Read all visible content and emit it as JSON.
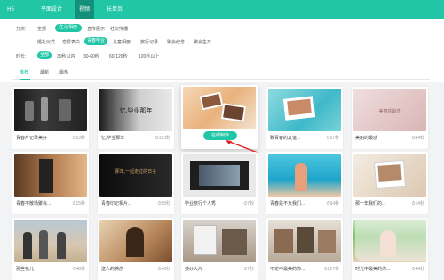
{
  "topnav": {
    "tabs": [
      "H5",
      "平面设计",
      "视频",
      "长单页"
    ],
    "active_index": 2
  },
  "filters": {
    "category_label": "分类:",
    "categories": [
      "全部",
      "生活相册",
      "宣传展示",
      "社交传播"
    ],
    "active_category_index": 1,
    "subcategories": [
      "婚礼仪式",
      "恋爱表白",
      "青春毕业",
      "儿童相册",
      "旅行记录",
      "聚会纪念",
      "聚会生日"
    ],
    "active_subcategory_index": 2,
    "duration_label": "时长:",
    "durations": [
      "全部",
      "30秒以内",
      "30-60秒",
      "60-120秒",
      "120秒以上"
    ],
    "active_duration_index": 0
  },
  "sort": {
    "tabs": [
      "推荐",
      "最新",
      "最热"
    ],
    "active_index": 0
  },
  "cards": [
    {
      "title": "青春片记录美好",
      "duration": "63秒",
      "caption": ""
    },
    {
      "title": "忆,毕业那年",
      "duration": "153秒",
      "caption": "忆,毕业那年"
    },
    {
      "title": "",
      "duration": "",
      "caption": "",
      "hover": true,
      "button": "在线制作"
    },
    {
      "title": "致青春的友谊...",
      "duration": "57秒",
      "caption": ""
    },
    {
      "title": "美丽的最感",
      "duration": "44秒",
      "caption": "美丽的最感"
    },
    {
      "title": "青春不散场聚会...",
      "duration": "15秒",
      "caption": ""
    },
    {
      "title": "青春印记相片...",
      "duration": "58秒",
      "caption": "那年,一起走过的日子"
    },
    {
      "title": "毕业旅行个人秀",
      "duration": "7秒",
      "caption": ""
    },
    {
      "title": "青春是不负我们...",
      "duration": "64秒",
      "caption": ""
    },
    {
      "title": "那一年我们的...",
      "duration": "14秒",
      "caption": ""
    },
    {
      "title": "那些花儿",
      "duration": "48秒",
      "caption": ""
    },
    {
      "title": "送人的腾彦",
      "duration": "48秒",
      "caption": ""
    },
    {
      "title": "孩纱大片",
      "duration": "7秒",
      "caption": ""
    },
    {
      "title": "不定中最美的你...",
      "duration": "217秒",
      "caption": ""
    },
    {
      "title": "时光中最美的你...",
      "duration": "44秒",
      "caption": ""
    }
  ],
  "colors": {
    "accent": "#20c6a5",
    "accent_dark": "#14907a"
  }
}
